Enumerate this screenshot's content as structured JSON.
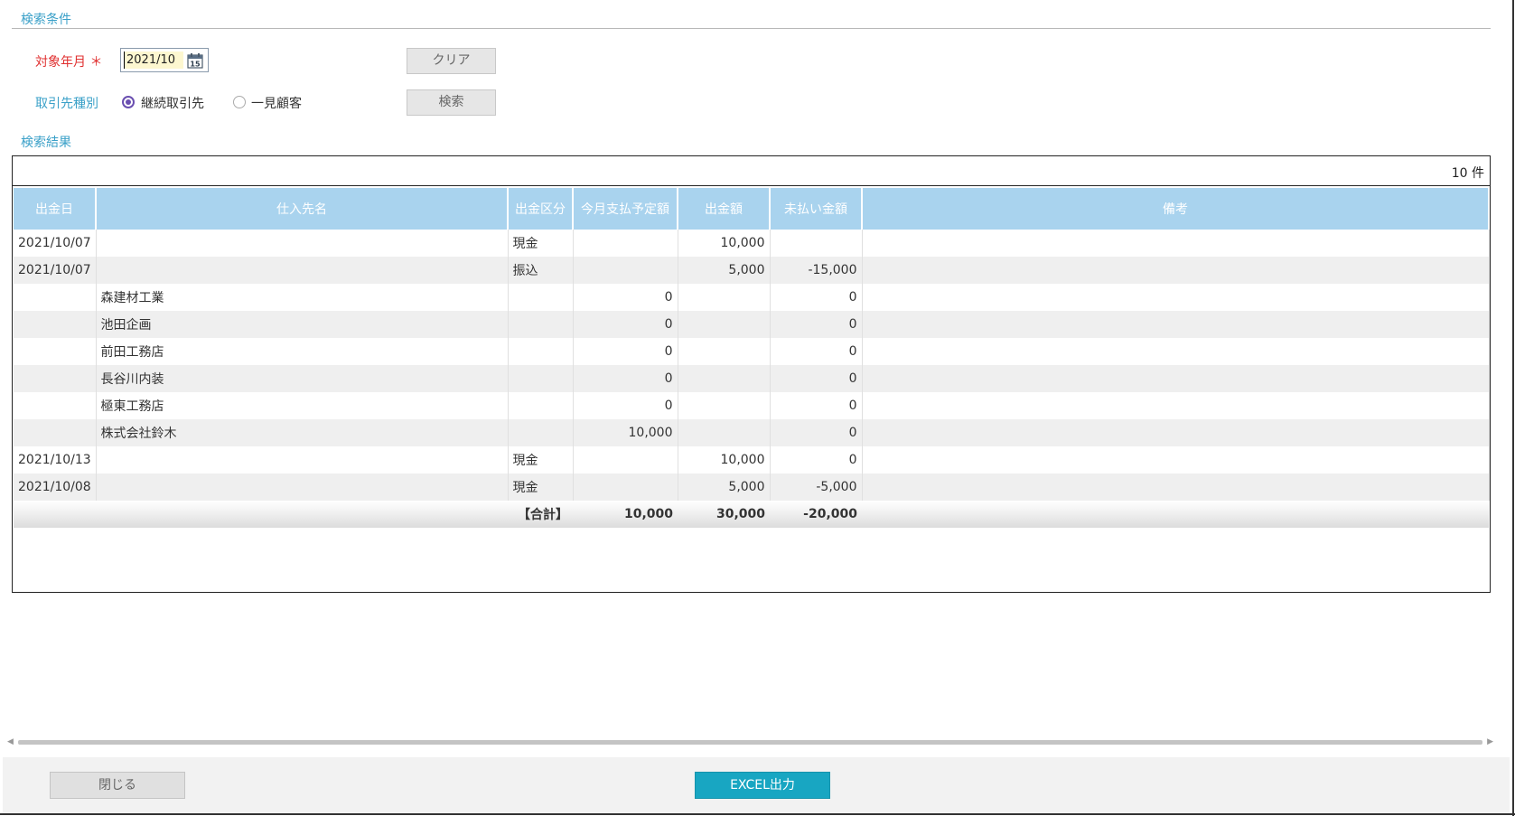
{
  "search": {
    "section_title": "検索条件",
    "target_month_label": "対象年月",
    "required_mark": "＊",
    "target_month_value": "2021/10",
    "partner_type_label": "取引先種別",
    "radio_continuous": "継続取引先",
    "radio_walkin": "一見顧客",
    "radio_selected": "継続取引先",
    "clear_button": "クリア",
    "search_button": "検索"
  },
  "results": {
    "section_title": "検索結果",
    "count_text": "10 件",
    "columns": [
      "出金日",
      "仕入先名",
      "出金区分",
      "今月支払予定額",
      "出金額",
      "未払い金額",
      "備考"
    ],
    "rows": [
      {
        "date": "2021/10/07",
        "supplier": "",
        "type": "現金",
        "planned": "",
        "paid": "10,000",
        "unpaid": "",
        "note": ""
      },
      {
        "date": "2021/10/07",
        "supplier": "",
        "type": "振込",
        "planned": "",
        "paid": "5,000",
        "unpaid": "-15,000",
        "note": ""
      },
      {
        "date": "",
        "supplier": "森建材工業",
        "type": "",
        "planned": "0",
        "paid": "",
        "unpaid": "0",
        "note": ""
      },
      {
        "date": "",
        "supplier": "池田企画",
        "type": "",
        "planned": "0",
        "paid": "",
        "unpaid": "0",
        "note": ""
      },
      {
        "date": "",
        "supplier": "前田工務店",
        "type": "",
        "planned": "0",
        "paid": "",
        "unpaid": "0",
        "note": ""
      },
      {
        "date": "",
        "supplier": "長谷川内装",
        "type": "",
        "planned": "0",
        "paid": "",
        "unpaid": "0",
        "note": ""
      },
      {
        "date": "",
        "supplier": "極東工務店",
        "type": "",
        "planned": "0",
        "paid": "",
        "unpaid": "0",
        "note": ""
      },
      {
        "date": "",
        "supplier": "株式会社鈴木",
        "type": "",
        "planned": "10,000",
        "paid": "",
        "unpaid": "0",
        "note": ""
      },
      {
        "date": "2021/10/13",
        "supplier": "",
        "type": "現金",
        "planned": "",
        "paid": "10,000",
        "unpaid": "0",
        "note": ""
      },
      {
        "date": "2021/10/08",
        "supplier": "",
        "type": "現金",
        "planned": "",
        "paid": "5,000",
        "unpaid": "-5,000",
        "note": ""
      }
    ],
    "total": {
      "label": "【合計】",
      "planned": "10,000",
      "paid": "30,000",
      "unpaid": "-20,000"
    }
  },
  "footer": {
    "close_button": "閉じる",
    "excel_button": "EXCEL出力"
  },
  "colors": {
    "accent": "#3aa0c8",
    "header_bg": "#a9d3ee",
    "excel_button": "#18a6c2",
    "required": "#e03030"
  }
}
